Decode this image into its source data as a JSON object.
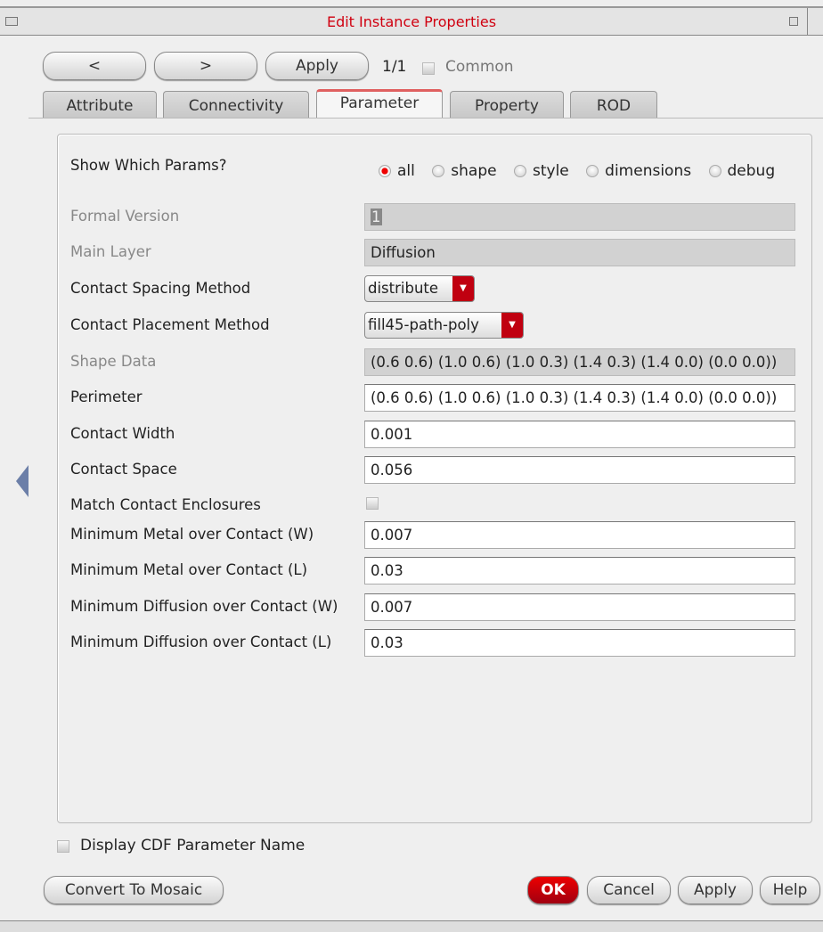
{
  "window": {
    "title": "Edit Instance Properties"
  },
  "toolbar": {
    "prev": "<",
    "next": ">",
    "apply": "Apply",
    "counter": "1/1",
    "common": "Common"
  },
  "tabs": [
    "Attribute",
    "Connectivity",
    "Parameter",
    "Property",
    "ROD"
  ],
  "show_params": {
    "label": "Show Which Params?",
    "options": [
      "all",
      "shape",
      "style",
      "dimensions",
      "debug"
    ],
    "selected": "all"
  },
  "params": [
    {
      "label": "Formal Version",
      "value": "1",
      "type": "readonly"
    },
    {
      "label": "Main Layer",
      "value": "Diffusion",
      "type": "readonly"
    },
    {
      "label": "Contact Spacing Method",
      "value": "distribute",
      "type": "combo"
    },
    {
      "label": "Contact Placement Method",
      "value": "fill45-path-poly",
      "type": "combo"
    },
    {
      "label": "Shape Data",
      "value": "(0.6 0.6) (1.0 0.6) (1.0 0.3) (1.4 0.3) (1.4 0.0) (0.0 0.0))",
      "type": "readonly"
    },
    {
      "label": "Perimeter",
      "value": "(0.6 0.6) (1.0 0.6) (1.0 0.3) (1.4 0.3) (1.4 0.0) (0.0 0.0))",
      "type": "text"
    },
    {
      "label": "Contact Width",
      "value": "0.001",
      "type": "text"
    },
    {
      "label": "Contact Space",
      "value": "0.056",
      "type": "text"
    },
    {
      "label": "Match Contact Enclosures",
      "value": "",
      "type": "check"
    },
    {
      "label": "Minimum Metal over Contact (W)",
      "value": "0.007",
      "type": "text"
    },
    {
      "label": "Minimum Metal over Contact (L)",
      "value": "0.03",
      "type": "text"
    },
    {
      "label": "Minimum Diffusion over Contact (W)",
      "value": "0.007",
      "type": "text"
    },
    {
      "label": "Minimum Diffusion over Contact (L)",
      "value": "0.03",
      "type": "text"
    }
  ],
  "footer": {
    "display_cdf": "Display CDF Parameter Name",
    "convert": "Convert To Mosaic",
    "ok": "OK",
    "cancel": "Cancel",
    "apply": "Apply",
    "help": "Help"
  }
}
